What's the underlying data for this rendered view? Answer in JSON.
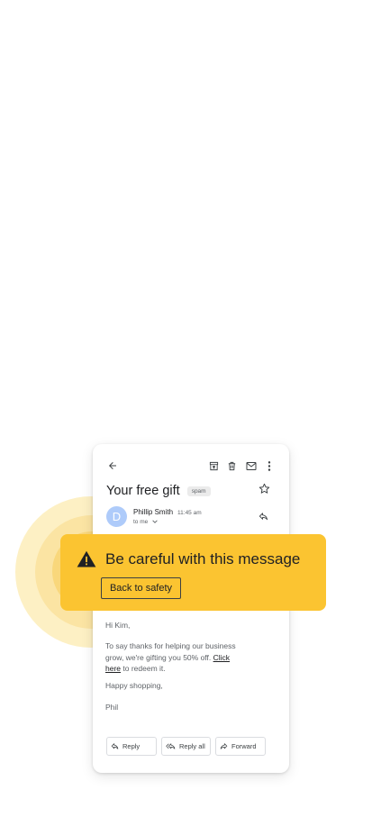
{
  "toolbar": {
    "icons": [
      "back-arrow-icon",
      "archive-icon",
      "trash-icon",
      "mail-icon",
      "more-vert-icon"
    ]
  },
  "email": {
    "subject": "Your free gift",
    "label": "spam",
    "sender": {
      "initial": "D",
      "name": "Phillip Smith",
      "time": "11:45 am",
      "recipient": "to me"
    },
    "greeting": "Hi Kim,",
    "body_part1": "To say thanks for helping our business grow, we're gifting you 50% off.",
    "link_text": "Click here",
    "body_part2": "to redeem it.",
    "sign_off": "Happy shopping,",
    "signature": "Phil"
  },
  "actions": {
    "reply": "Reply",
    "reply_all": "Reply all",
    "forward": "Forward"
  },
  "warning": {
    "title": "Be careful with this message",
    "button": "Back to safety",
    "color": "#fbc431"
  },
  "colors": {
    "avatar": "#aecbfa",
    "halo": "#f9d77b"
  }
}
